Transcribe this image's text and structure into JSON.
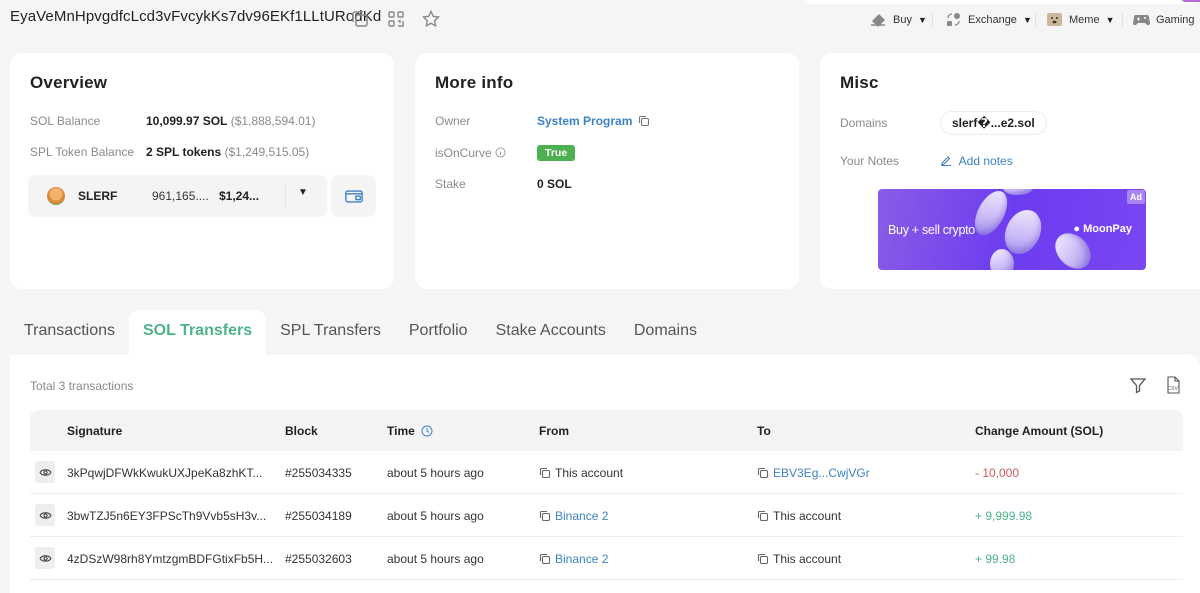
{
  "header": {
    "address": "EyaVeMnHpvgdfcLcd3vFvcykKs7dv96EKf1LLtURodKd",
    "icons": [
      "copy-icon",
      "qr-code-icon",
      "star-icon"
    ],
    "nav": [
      {
        "label": "Buy",
        "icon": "buy-icon"
      },
      {
        "label": "Exchange",
        "icon": "exchange-icon"
      },
      {
        "label": "Meme",
        "icon": "meme-icon"
      },
      {
        "label": "Gaming",
        "icon": "gaming-icon"
      }
    ]
  },
  "overview": {
    "title": "Overview",
    "sol_balance_label": "SOL Balance",
    "sol_balance_value": "10,099.97 SOL",
    "sol_balance_usd": "($1,888,594.01)",
    "spl_label": "SPL Token Balance",
    "spl_value": "2 SPL tokens",
    "spl_usd": "($1,249,515.05)",
    "token": {
      "name": "SLERF",
      "amount": "961,165....",
      "usd": "$1,24..."
    }
  },
  "more_info": {
    "title": "More info",
    "owner_label": "Owner",
    "owner_value": "System Program",
    "oncurve_label": "isOnCurve",
    "oncurve_value": "True",
    "stake_label": "Stake",
    "stake_value": "0 SOL"
  },
  "misc": {
    "title": "Misc",
    "domains_label": "Domains",
    "domain_value": "slerf�...e2.sol",
    "notes_label": "Your Notes",
    "notes_action": "Add notes",
    "ad": {
      "text": "Buy + sell crypto",
      "brand": "MoonPay",
      "badge": "Ad"
    }
  },
  "tabs": [
    {
      "label": "Transactions",
      "active": false
    },
    {
      "label": "SOL Transfers",
      "active": true
    },
    {
      "label": "SPL Transfers",
      "active": false
    },
    {
      "label": "Portfolio",
      "active": false
    },
    {
      "label": "Stake Accounts",
      "active": false
    },
    {
      "label": "Domains",
      "active": false
    }
  ],
  "transfers": {
    "total_text": "Total 3 transactions",
    "columns": [
      "Signature",
      "Block",
      "Time",
      "From",
      "To",
      "Change Amount (SOL)"
    ],
    "rows": [
      {
        "signature": "3kPqwjDFWkKwukUXJpeKa8zhKT...",
        "block": "#255034335",
        "time": "about 5 hours ago",
        "from": "This account",
        "from_link": false,
        "to": "EBV3Eg...CwjVGr",
        "to_link": true,
        "amount": "- 10,000",
        "direction": "out"
      },
      {
        "signature": "3bwTZJ5n6EY3FPScTh9Vvb5sH3v...",
        "block": "#255034189",
        "time": "about 5 hours ago",
        "from": "Binance 2",
        "from_link": true,
        "to": "This account",
        "to_link": false,
        "amount": "+ 9,999.98",
        "direction": "in"
      },
      {
        "signature": "4zDSzW98rh8YmtzgmBDFGtixFb5H...",
        "block": "#255032603",
        "time": "about 5 hours ago",
        "from": "Binance 2",
        "from_link": true,
        "to": "This account",
        "to_link": false,
        "amount": "+ 99.98",
        "direction": "in"
      }
    ]
  },
  "colors": {
    "link": "#3d82c4",
    "accent_green": "#4db38a",
    "negative": "#d05a5a",
    "badge_true": "#4caf50"
  }
}
